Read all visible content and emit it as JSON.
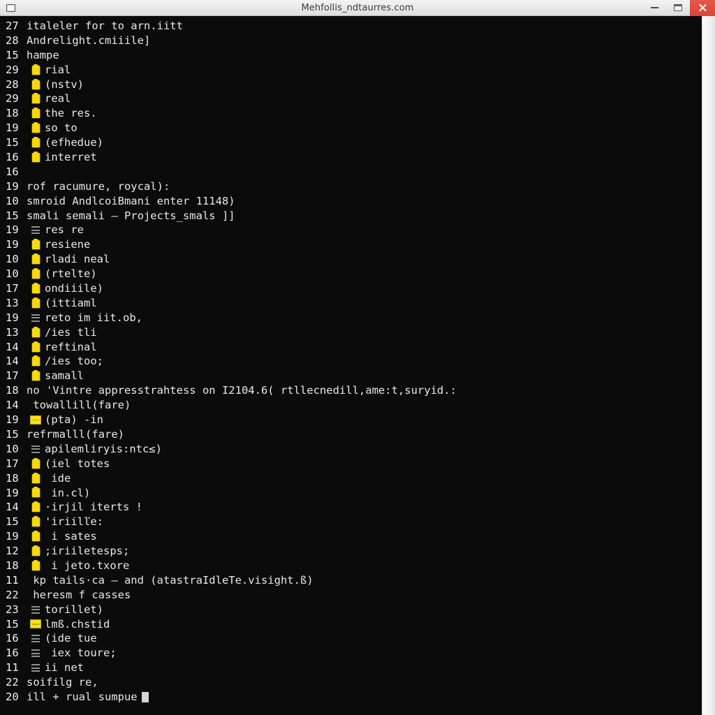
{
  "window": {
    "title": "Mehfollis_ndtaurres.com",
    "app_icon": "terminal-window-icon",
    "controls": {
      "minimize": "minimize-icon",
      "maximize": "maximize-icon",
      "close": "close-icon"
    },
    "close_color": "#d8453a",
    "titlebar_bg": "#e9e9e9"
  },
  "terminal": {
    "background": "#0b0b0b",
    "foreground": "#e8e8e8",
    "icon_folder_color": "#f5d908",
    "icon_lines_color": "#8f8f8f",
    "cursor": "block-cursor",
    "lines": [
      {
        "n": "27",
        "icon": "none",
        "text": "italeler for to arn.iitt"
      },
      {
        "n": "28",
        "icon": "none",
        "text": "Andrelight.cmiiile]"
      },
      {
        "n": "15",
        "icon": "none",
        "text": "hampe"
      },
      {
        "n": "29",
        "icon": "folder",
        "text": "rial"
      },
      {
        "n": "28",
        "icon": "folder",
        "text": "(nstv)"
      },
      {
        "n": "29",
        "icon": "folder",
        "text": "real"
      },
      {
        "n": "18",
        "icon": "folder",
        "text": "the res."
      },
      {
        "n": "19",
        "icon": "folder",
        "text": "so to"
      },
      {
        "n": "15",
        "icon": "folder",
        "text": "(efhedue)"
      },
      {
        "n": "16",
        "icon": "folder",
        "text": "interret"
      },
      {
        "n": "16",
        "icon": "none",
        "text": ""
      },
      {
        "n": "19",
        "icon": "none",
        "text": "rof racumure, roycal):"
      },
      {
        "n": "10",
        "icon": "none",
        "text": "smroid AndlcoiBmani enter 11148)"
      },
      {
        "n": "15",
        "icon": "none",
        "text": "smali semali – Projects_smals ]]"
      },
      {
        "n": "19",
        "icon": "lines",
        "text": "res re"
      },
      {
        "n": "19",
        "icon": "folder",
        "text": "resiene"
      },
      {
        "n": "10",
        "icon": "folder",
        "text": "rladi neal"
      },
      {
        "n": "10",
        "icon": "folder",
        "text": "(rtelte)"
      },
      {
        "n": "17",
        "icon": "folder",
        "text": "ondiiile)"
      },
      {
        "n": "13",
        "icon": "folder",
        "text": "(ittiaml"
      },
      {
        "n": "19",
        "icon": "lines",
        "text": "reto im iit.ob,"
      },
      {
        "n": "13",
        "icon": "folder",
        "text": "/ies tli"
      },
      {
        "n": "14",
        "icon": "folder",
        "text": "reftinal"
      },
      {
        "n": "14",
        "icon": "folder",
        "text": "/ies too;"
      },
      {
        "n": "17",
        "icon": "folder",
        "text": "samall"
      },
      {
        "n": "18",
        "icon": "none",
        "text": "no 'Vintre appresstrahtess on I2104.6( rtllecnedill,ame:t,suryid.:"
      },
      {
        "n": "14",
        "icon": "none",
        "text": " towallill(fare)"
      },
      {
        "n": "19",
        "icon": "folder-open",
        "text": "(pta) -in"
      },
      {
        "n": "15",
        "icon": "none",
        "text": "refrmalll(fare)"
      },
      {
        "n": "10",
        "icon": "lines",
        "text": "apilemliryis:ntc≤)"
      },
      {
        "n": "17",
        "icon": "folder",
        "text": "(iel totes"
      },
      {
        "n": "18",
        "icon": "folder",
        "text": " ide"
      },
      {
        "n": "19",
        "icon": "folder",
        "text": " in.cl)"
      },
      {
        "n": "14",
        "icon": "folder",
        "text": "·irjil iterts !"
      },
      {
        "n": "15",
        "icon": "folder",
        "text": "'iriilľe:"
      },
      {
        "n": "19",
        "icon": "folder",
        "text": " i sates"
      },
      {
        "n": "12",
        "icon": "folder",
        "text": ";iriiletesps;"
      },
      {
        "n": "18",
        "icon": "folder",
        "text": " i jeto.txore"
      },
      {
        "n": "11",
        "icon": "none",
        "text": " kp tails·ca – and (atastraIdleTe.visight.ß)"
      },
      {
        "n": "22",
        "icon": "none",
        "text": " heresm f casses"
      },
      {
        "n": "23",
        "icon": "lines",
        "text": "torillet)"
      },
      {
        "n": "15",
        "icon": "folder-open",
        "text": "lmß.chstid"
      },
      {
        "n": "16",
        "icon": "lines",
        "text": "(ide tue"
      },
      {
        "n": "16",
        "icon": "lines",
        "text": " iex toure;"
      },
      {
        "n": "11",
        "icon": "lines",
        "text": "ii net"
      },
      {
        "n": "22",
        "icon": "none",
        "text": "soifilg re,"
      },
      {
        "n": "20",
        "icon": "none",
        "text": "ill + rual sumpue",
        "cursor": true
      }
    ]
  }
}
